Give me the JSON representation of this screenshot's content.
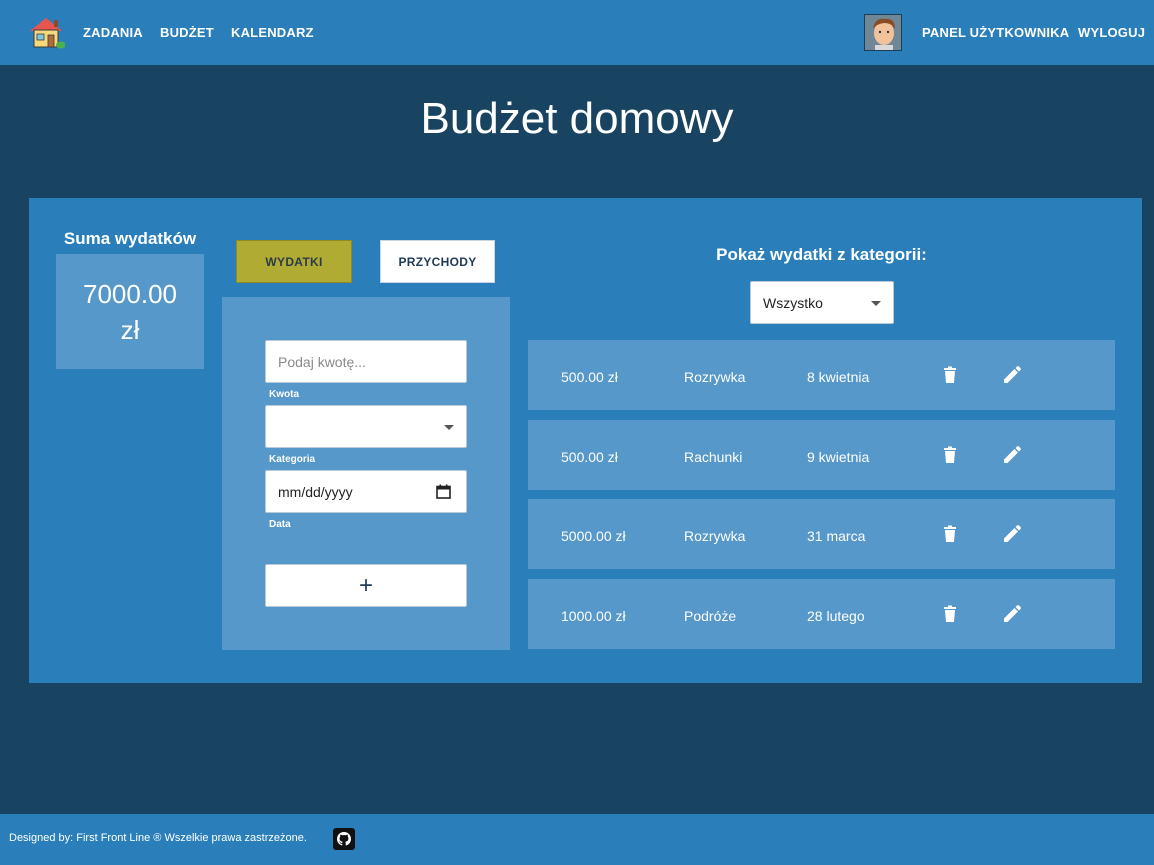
{
  "nav": {
    "logo_icon": "house-icon",
    "links": [
      "ZADANIA",
      "BUDŻET",
      "KALENDARZ"
    ],
    "user_panel": "PANEL UŻYTKOWNIKA",
    "logout": "WYLOGUJ",
    "avatar_icon": "user-avatar"
  },
  "page": {
    "title": "Budżet domowy"
  },
  "summary": {
    "title": "Suma wydatków",
    "value": "7000.00 zł"
  },
  "tabs": {
    "expenses": "WYDATKI",
    "income": "PRZYCHODY",
    "active": "WYDATKI"
  },
  "form": {
    "amount_placeholder": "Podaj kwotę...",
    "amount_label": "Kwota",
    "category_value": "",
    "category_label": "Kategoria",
    "date_value": "mm/dd/yyyy",
    "date_label": "Data",
    "add_label": "+"
  },
  "filter": {
    "title": "Pokaż wydatki z kategorii:",
    "selected": "Wszystko"
  },
  "expenses": [
    {
      "amount": "500.00 zł",
      "category": "Rozrywka",
      "date": "8 kwietnia"
    },
    {
      "amount": "500.00 zł",
      "category": "Rachunki",
      "date": "9 kwietnia"
    },
    {
      "amount": "5000.00 zł",
      "category": "Rozrywka",
      "date": "31 marca"
    },
    {
      "amount": "1000.00 zł",
      "category": "Podróże",
      "date": "28 lutego"
    }
  ],
  "footer": {
    "text": "Designed by: First Front Line ® Wszelkie prawa zastrzeżone.",
    "icon": "github-icon"
  },
  "colors": {
    "background": "#184361",
    "bar": "#2a7fba",
    "card": "#5598c9",
    "active_tab": "#b0ac33"
  }
}
